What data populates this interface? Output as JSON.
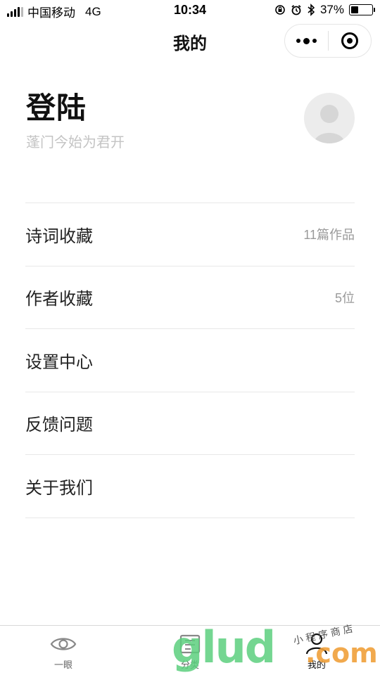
{
  "status_bar": {
    "carrier": "中国移动",
    "network": "4G",
    "time": "10:34",
    "battery": "37%",
    "battery_level": 0.37
  },
  "nav": {
    "title": "我的"
  },
  "profile": {
    "title": "登陆",
    "subtitle": "蓬门今始为君开"
  },
  "menu": {
    "items": [
      {
        "label": "诗词收藏",
        "value": "11篇作品"
      },
      {
        "label": "作者收藏",
        "value": "5位"
      },
      {
        "label": "设置中心",
        "value": ""
      },
      {
        "label": "反馈问题",
        "value": ""
      },
      {
        "label": "关于我们",
        "value": ""
      }
    ]
  },
  "tabs": [
    {
      "label": "一眼",
      "icon": "eye-icon"
    },
    {
      "label": "分类",
      "icon": "category-icon"
    },
    {
      "label": "我的",
      "icon": "person-icon",
      "active": true
    }
  ],
  "watermark": {
    "main": "glud",
    "suffix": ".com",
    "small": "小程序商店"
  },
  "colors": {
    "accent": "#000000",
    "muted_text": "#9a9a9a",
    "subtitle": "#c4c4c4",
    "divider": "#e8e8e8"
  }
}
